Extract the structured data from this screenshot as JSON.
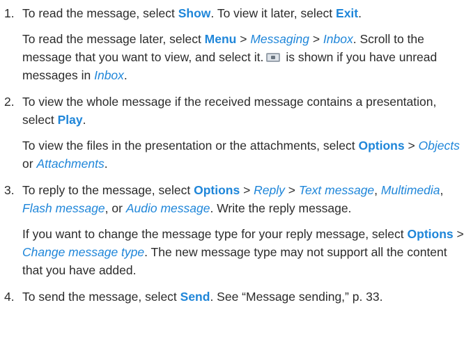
{
  "steps": [
    {
      "number": "1.",
      "main": {
        "t1": "To read the message, select ",
        "k1": "Show",
        "t2": ". To view it later, select ",
        "k2": "Exit",
        "t3": "."
      },
      "sub": {
        "t1": "To read the message later, select ",
        "k1": "Menu",
        "sep1": " > ",
        "i1": "Messaging",
        "sep2": " > ",
        "i2": "Inbox",
        "t2": ". Scroll to the message that you want to view, and select it.",
        "t3": "is shown if you have unread messages in ",
        "i3": "Inbox",
        "t4": "."
      },
      "icon": "unread-message-icon"
    },
    {
      "number": "2.",
      "main": {
        "t1": "To view the whole message if the received message contains a presentation, select ",
        "k1": "Play",
        "t2": "."
      },
      "sub": {
        "t1": "To view the files in the presentation or the attachments, select ",
        "k1": "Options",
        "sep1": " > ",
        "i1": "Objects",
        "t2": " or ",
        "i2": "Attachments",
        "t3": "."
      }
    },
    {
      "number": "3.",
      "main": {
        "t1": "To reply to the message, select ",
        "k1": "Options",
        "sep1": " > ",
        "i1": "Reply",
        "sep2": " > ",
        "i2": "Text message",
        "c1": ", ",
        "i3": "Multimedia",
        "c2": ", ",
        "i4": "Flash message",
        "c3": ", or ",
        "i5": "Audio message",
        "t2": ". Write the reply message."
      },
      "sub": {
        "t1": "If you want to change the message type for your reply message, select ",
        "k1": "Options",
        "sep1": " > ",
        "i1": "Change message type",
        "t2": ". The new message type may not support all the content that you have added."
      }
    },
    {
      "number": "4.",
      "main": {
        "t1": "To send the message, select ",
        "k1": "Send",
        "t2": ". See “Message sending,” p. 33."
      }
    }
  ]
}
